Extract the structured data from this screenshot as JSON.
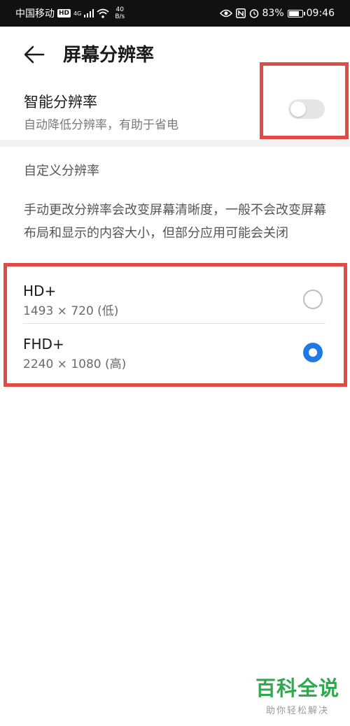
{
  "status_bar": {
    "carrier": "中国移动",
    "hd_badge": "HD",
    "network": "4G",
    "speed_value": "40",
    "speed_unit": "B/s",
    "icons": [
      "hd-icon",
      "signal-icon",
      "wifi-icon",
      "eye-icon",
      "nfc-icon",
      "alarm-icon",
      "battery-icon"
    ],
    "battery": "83%",
    "time": "09:46"
  },
  "header": {
    "title": "屏幕分辨率",
    "back_icon": "back-arrow-icon"
  },
  "smart_resolution": {
    "title": "智能分辨率",
    "subtitle": "自动降低分辨率，有助于省电",
    "enabled": false
  },
  "custom_resolution": {
    "section_label": "自定义分辨率",
    "description": "手动更改分辨率会改变屏幕清晰度，一般不会改变屏幕布局和显示的内容大小，但部分应用可能会关闭",
    "options": [
      {
        "name": "HD+",
        "dimensions": "1493 × 720 (低)",
        "selected": false
      },
      {
        "name": "FHD+",
        "dimensions": "2240 × 1080 (高)",
        "selected": true
      }
    ]
  },
  "colors": {
    "accent": "#1f7ae6",
    "highlight": "#e04c45",
    "watermark": "#2fa84f"
  },
  "watermark": {
    "title": "百科全说",
    "subtitle": "助你轻松解决"
  }
}
